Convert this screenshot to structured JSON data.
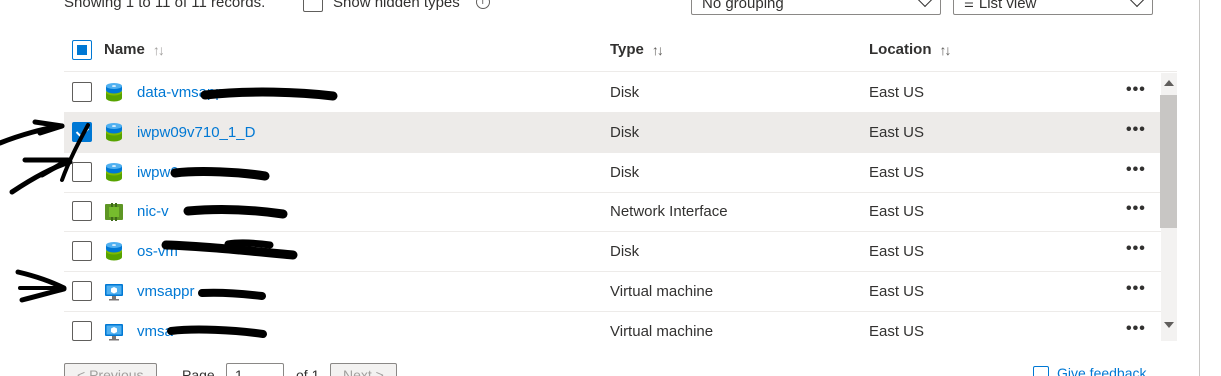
{
  "toolbar": {
    "records_text": "Showing 1 to 11 of 11 records.",
    "show_hidden_label": "Show hidden types",
    "grouping_value": "No grouping",
    "view_value": "List view"
  },
  "table": {
    "columns": {
      "name": "Name",
      "type": "Type",
      "location": "Location"
    },
    "rows": [
      {
        "name": "data-vmsapp",
        "type": "Disk",
        "location": "East US",
        "icon": "disk-icon",
        "checked": false
      },
      {
        "name": "iwpw09v710_1_D",
        "type": "Disk",
        "location": "East US",
        "icon": "disk-icon",
        "checked": true
      },
      {
        "name": "iwpw0",
        "type": "Disk",
        "location": "East US",
        "icon": "disk-icon",
        "checked": false
      },
      {
        "name": "nic-v",
        "type": "Network Interface",
        "location": "East US",
        "icon": "network-interface-icon",
        "checked": false
      },
      {
        "name": "os-vm",
        "type": "Disk",
        "location": "East US",
        "icon": "disk-icon",
        "checked": false
      },
      {
        "name": "vmsappr",
        "type": "Virtual machine",
        "location": "East US",
        "icon": "virtual-machine-icon",
        "checked": false
      },
      {
        "name": "vmsa",
        "type": "Virtual machine",
        "location": "East US",
        "icon": "virtual-machine-icon",
        "checked": false
      }
    ],
    "more_label": "•••"
  },
  "pager": {
    "previous_label": "< Previous",
    "page_label": "Page",
    "page_value": "1",
    "of_label": "of 1",
    "next_label": "Next >"
  },
  "feedback_label": "Give feedback",
  "colors": {
    "accent": "#0078d4",
    "selected_row": "#edebe9"
  }
}
